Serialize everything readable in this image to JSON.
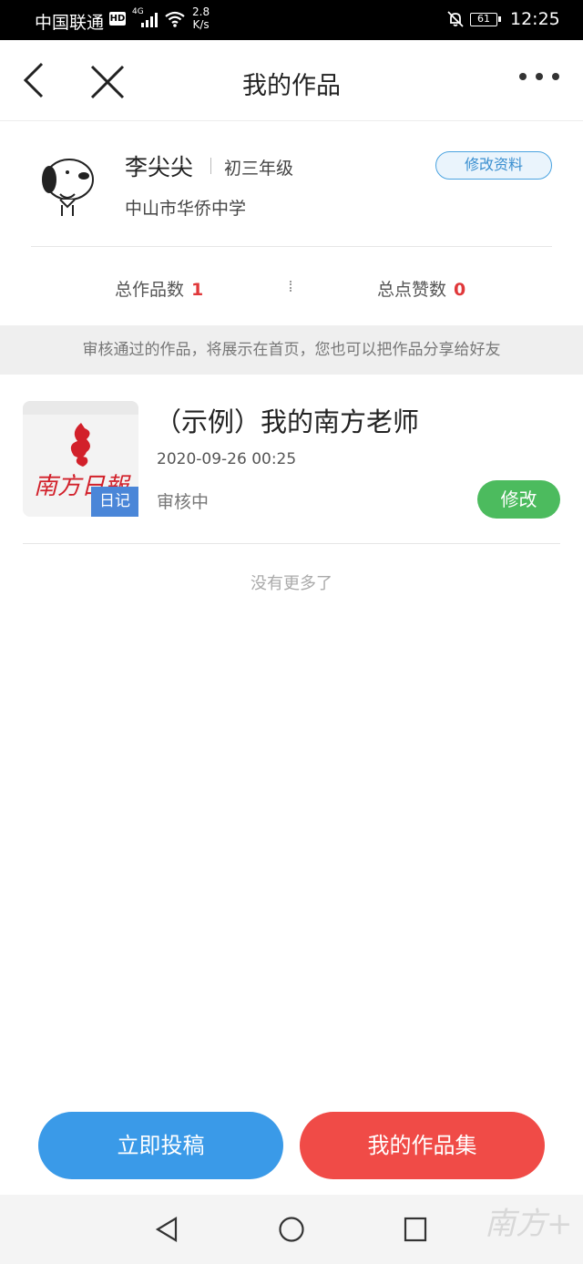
{
  "status_bar": {
    "carrier": "中国联通",
    "hd": "HD",
    "network": "4G",
    "speed_value": "2.8",
    "speed_unit": "K/s",
    "battery": "61",
    "time": "12:25"
  },
  "nav": {
    "title": "我的作品",
    "icons": [
      "chevron-left-icon",
      "close-icon",
      "more-icon"
    ]
  },
  "profile": {
    "name": "李尖尖",
    "grade": "初三年级",
    "school": "中山市华侨中学",
    "edit_label": "修改资料",
    "stats": {
      "works_label": "总作品数",
      "works_count": "1",
      "likes_label": "总点赞数",
      "likes_count": "0"
    }
  },
  "notice": "审核通过的作品，将展示在首页，您也可以把作品分享给好友",
  "works": [
    {
      "title": "（示例）我的南方老师",
      "date": "2020-09-26 00:25",
      "status": "审核中",
      "category": "日记",
      "edit_label": "修改",
      "thumbnail_logo": "南方日報"
    }
  ],
  "list_end": "没有更多了",
  "actions": {
    "submit": "立即投稿",
    "collection": "我的作品集"
  },
  "watermark": "南方+",
  "colors": {
    "accent_blue": "#3a9ae8",
    "accent_red": "#f04b47",
    "success_green": "#4cbb5e",
    "count_red": "#e0383a"
  }
}
